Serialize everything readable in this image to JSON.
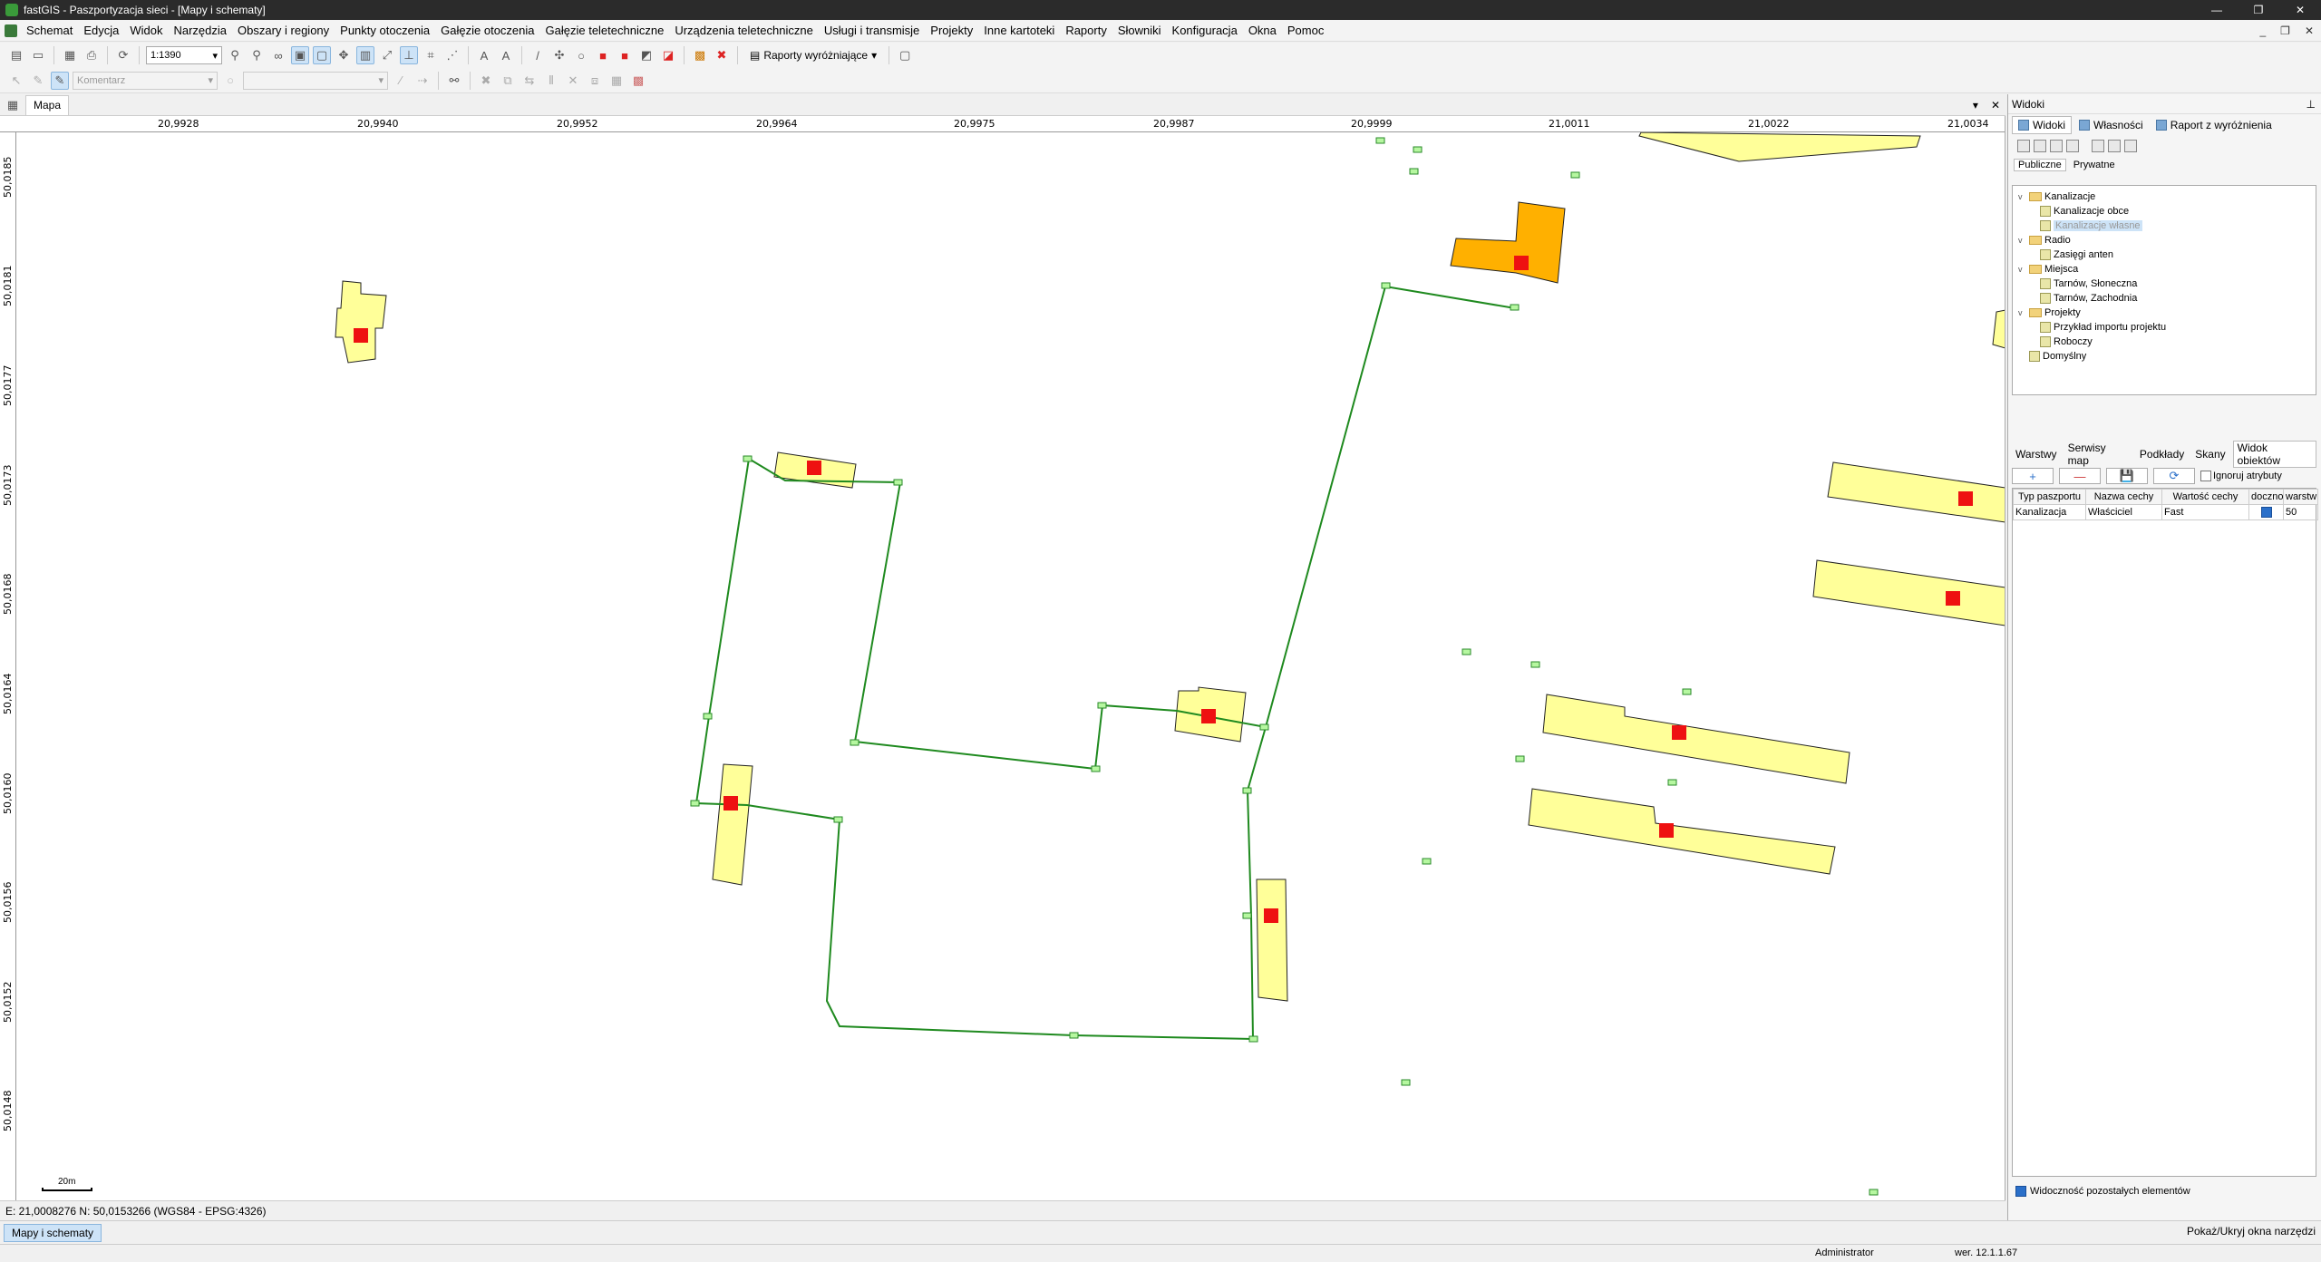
{
  "window": {
    "title": "fastGIS - Paszportyzacja sieci - [Mapy i schematy]",
    "min": "—",
    "max": "❐",
    "close": "✕"
  },
  "menu": {
    "items": [
      "Schemat",
      "Edycja",
      "Widok",
      "Narzędzia",
      "Obszary i regiony",
      "Punkty otoczenia",
      "Gałęzie otoczenia",
      "Gałęzie teletechniczne",
      "Urządzenia teletechniczne",
      "Usługi i transmisje",
      "Projekty",
      "Inne kartoteki",
      "Raporty",
      "Słowniki",
      "Konfiguracja",
      "Okna",
      "Pomoc"
    ],
    "mdi": [
      "_",
      "❐",
      "✕"
    ]
  },
  "toolbar1": {
    "scale_value": "1:1390",
    "reports_label": "Raporty wyróżniające"
  },
  "toolbar2": {
    "comment_placeholder": "Komentarz"
  },
  "map_tab": {
    "label": "Mapa",
    "pin": "▾",
    "close": "✕"
  },
  "rulers": {
    "top": [
      "20,9928",
      "20,9940",
      "20,9952",
      "20,9964",
      "20,9975",
      "20,9987",
      "20,9999",
      "21,0011",
      "21,0022",
      "21,0034"
    ],
    "left": [
      "50,0185",
      "50,0181",
      "50,0177",
      "50,0173",
      "50,0168",
      "50,0164",
      "50,0160",
      "50,0156",
      "50,0152",
      "50,0148"
    ]
  },
  "scale_bar": {
    "label": "20m"
  },
  "coords": {
    "text": "E: 21,0008276  N: 50,0153266 (WGS84 - EPSG:4326)"
  },
  "bottom_tabs": {
    "active": "Mapy i schematy",
    "toggle_tools": "Pokaż/Ukryj okna narzędzi"
  },
  "status": {
    "user": "Administrator",
    "version": "wer. 12.1.1.67"
  },
  "panel": {
    "title": "Widoki",
    "pin": "⊥",
    "tabs": [
      "Widoki",
      "Własności",
      "Raport z wyróżnienia"
    ],
    "subtabs": [
      "Publiczne",
      "Prywatne"
    ],
    "tree": [
      {
        "level": 0,
        "type": "folder",
        "label": "Kanalizacje",
        "exp": "v"
      },
      {
        "level": 1,
        "type": "view",
        "label": "Kanalizacje obce"
      },
      {
        "level": 1,
        "type": "view",
        "label": "Kanalizacje własne",
        "selected": true
      },
      {
        "level": 0,
        "type": "folder",
        "label": "Radio",
        "exp": "v"
      },
      {
        "level": 1,
        "type": "view",
        "label": "Zasięgi anten"
      },
      {
        "level": 0,
        "type": "folder",
        "label": "Miejsca",
        "exp": "v"
      },
      {
        "level": 1,
        "type": "view",
        "label": "Tarnów, Słoneczna"
      },
      {
        "level": 1,
        "type": "view",
        "label": "Tarnów, Zachodnia"
      },
      {
        "level": 0,
        "type": "folder",
        "label": "Projekty",
        "exp": "v"
      },
      {
        "level": 1,
        "type": "view",
        "label": "Przykład importu projektu"
      },
      {
        "level": 1,
        "type": "view",
        "label": "Roboczy"
      },
      {
        "level": 0,
        "type": "view",
        "label": "Domyślny"
      }
    ],
    "lower_tabs": [
      "Warstwy",
      "Serwisy map",
      "Podkłady",
      "Skany",
      "Widok obiektów"
    ],
    "add": "+",
    "remove": "—",
    "save": "💾",
    "refresh": "⟳",
    "ignore_attrs": "Ignoruj atrybuty",
    "grid": {
      "headers": [
        "Typ paszportu",
        "Nazwa cechy",
        "Wartość cechy",
        "doczno",
        "warstw"
      ],
      "rows": [
        {
          "type": "Kanalizacja",
          "name": "Właściciel",
          "value": "Fast",
          "checked": true,
          "layer": "50"
        }
      ]
    },
    "visibility_label": "Widoczność pozostałych elementów"
  },
  "colors": {
    "building": "#ffff99",
    "building_highlight": "#ffb000",
    "node": "#b6f7a0",
    "line": "#1f8a1f",
    "marker": "#ee1111"
  }
}
